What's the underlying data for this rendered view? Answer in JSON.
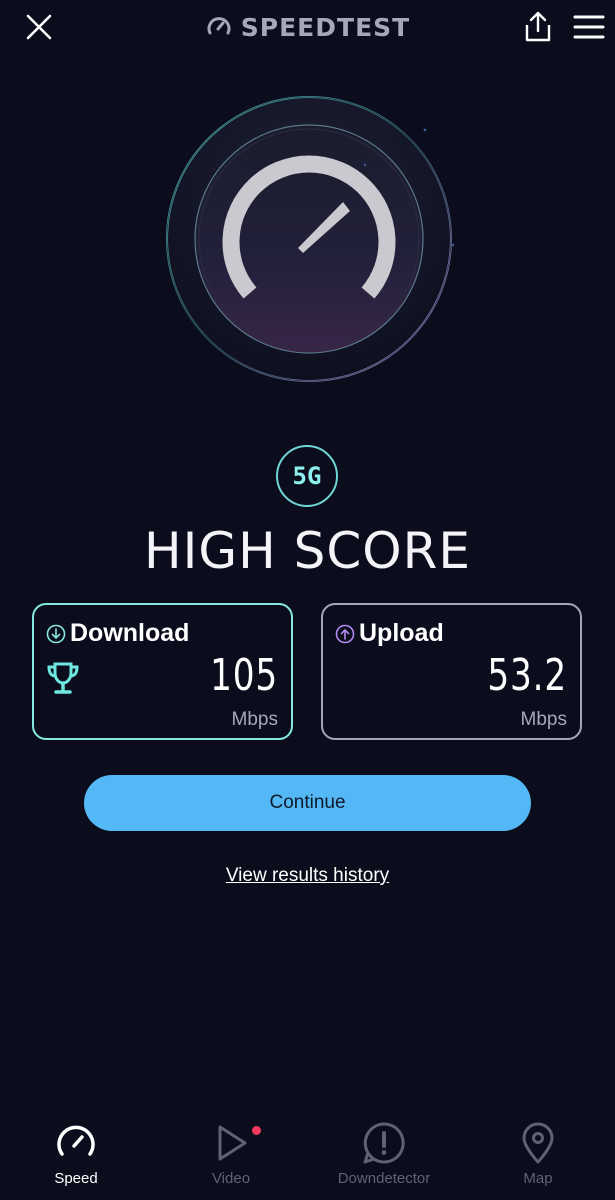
{
  "header": {
    "brand": "SPEEDTEST",
    "close_icon": "close-icon",
    "share_icon": "share-icon",
    "menu_icon": "hamburger-menu-icon"
  },
  "gauge": {
    "icon": "speedometer-icon"
  },
  "network": {
    "type": "5G"
  },
  "result": {
    "headline": "HIGH SCORE"
  },
  "download": {
    "label": "Download",
    "value": "105",
    "unit": "Mbps",
    "icon": "download-arrow-icon",
    "badge_icon": "trophy-icon"
  },
  "upload": {
    "label": "Upload",
    "value": "53.2",
    "unit": "Mbps",
    "icon": "upload-arrow-icon"
  },
  "actions": {
    "continue_label": "Continue",
    "history_label": "View results history"
  },
  "tabs": [
    {
      "label": "Speed",
      "icon": "speedometer-icon",
      "active": true
    },
    {
      "label": "Video",
      "icon": "play-icon",
      "active": false,
      "has_notification": true
    },
    {
      "label": "Downdetector",
      "icon": "alert-icon",
      "active": false
    },
    {
      "label": "Map",
      "icon": "map-pin-icon",
      "active": false
    }
  ],
  "colors": {
    "background": "#0b0d1c",
    "accent_teal": "#86e7e0",
    "accent_purple": "#b489f0",
    "button_blue": "#55b8f6",
    "notification_red": "#f03a5f"
  }
}
